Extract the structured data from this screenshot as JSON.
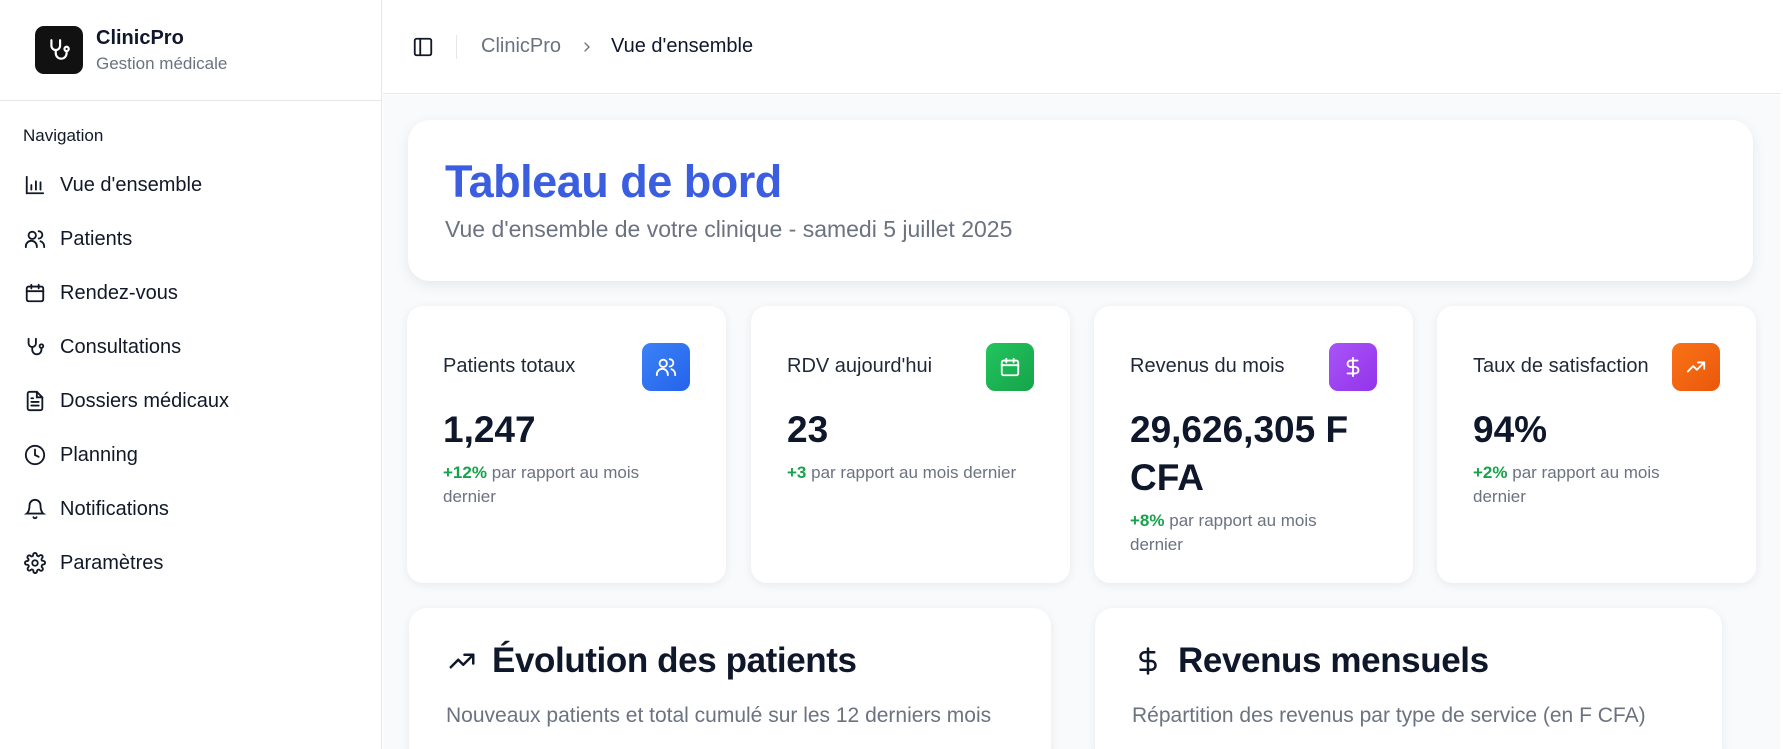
{
  "brand": {
    "name": "ClinicPro",
    "subtitle": "Gestion médicale",
    "icon": "stethoscope-icon"
  },
  "sidebar": {
    "section_title": "Navigation",
    "items": [
      {
        "label": "Vue d'ensemble",
        "icon": "bar-chart-icon"
      },
      {
        "label": "Patients",
        "icon": "users-icon"
      },
      {
        "label": "Rendez-vous",
        "icon": "calendar-icon"
      },
      {
        "label": "Consultations",
        "icon": "stethoscope-icon"
      },
      {
        "label": "Dossiers médicaux",
        "icon": "file-text-icon"
      },
      {
        "label": "Planning",
        "icon": "clock-icon"
      },
      {
        "label": "Notifications",
        "icon": "bell-icon"
      },
      {
        "label": "Paramètres",
        "icon": "gear-icon"
      }
    ]
  },
  "topbar": {
    "breadcrumb_root": "ClinicPro",
    "breadcrumb_current": "Vue d'ensemble"
  },
  "hero": {
    "title": "Tableau de bord",
    "subtitle": "Vue d'ensemble de votre clinique - samedi 5 juillet 2025"
  },
  "stats": [
    {
      "label": "Patients totaux",
      "value": "1,247",
      "delta": "+12%",
      "note": "par rapport au mois dernier",
      "icon": "users-icon",
      "color": "#3b82f6"
    },
    {
      "label": "RDV aujourd'hui",
      "value": "23",
      "delta": "+3",
      "note": "par rapport au mois dernier",
      "icon": "calendar-icon",
      "color": "#22c55e"
    },
    {
      "label": "Revenus du mois",
      "value": "29,626,305 F CFA",
      "delta": "+8%",
      "note": "par rapport au mois dernier",
      "icon": "dollar-icon",
      "color": "#a855f7"
    },
    {
      "label": "Taux de satisfaction",
      "value": "94%",
      "delta": "+2%",
      "note": "par rapport au mois dernier",
      "icon": "trending-up-icon",
      "color": "#f97316"
    }
  ],
  "panels": [
    {
      "title": "Évolution des patients",
      "subtitle": "Nouveaux patients et total cumulé sur les 12 derniers mois",
      "icon": "trending-up-icon"
    },
    {
      "title": "Revenus mensuels",
      "subtitle": "Répartition des revenus par type de service (en F CFA)",
      "icon": "dollar-icon"
    }
  ],
  "colors": {
    "accent_title": "#3b5ee0",
    "delta_positive": "#16a34a"
  }
}
